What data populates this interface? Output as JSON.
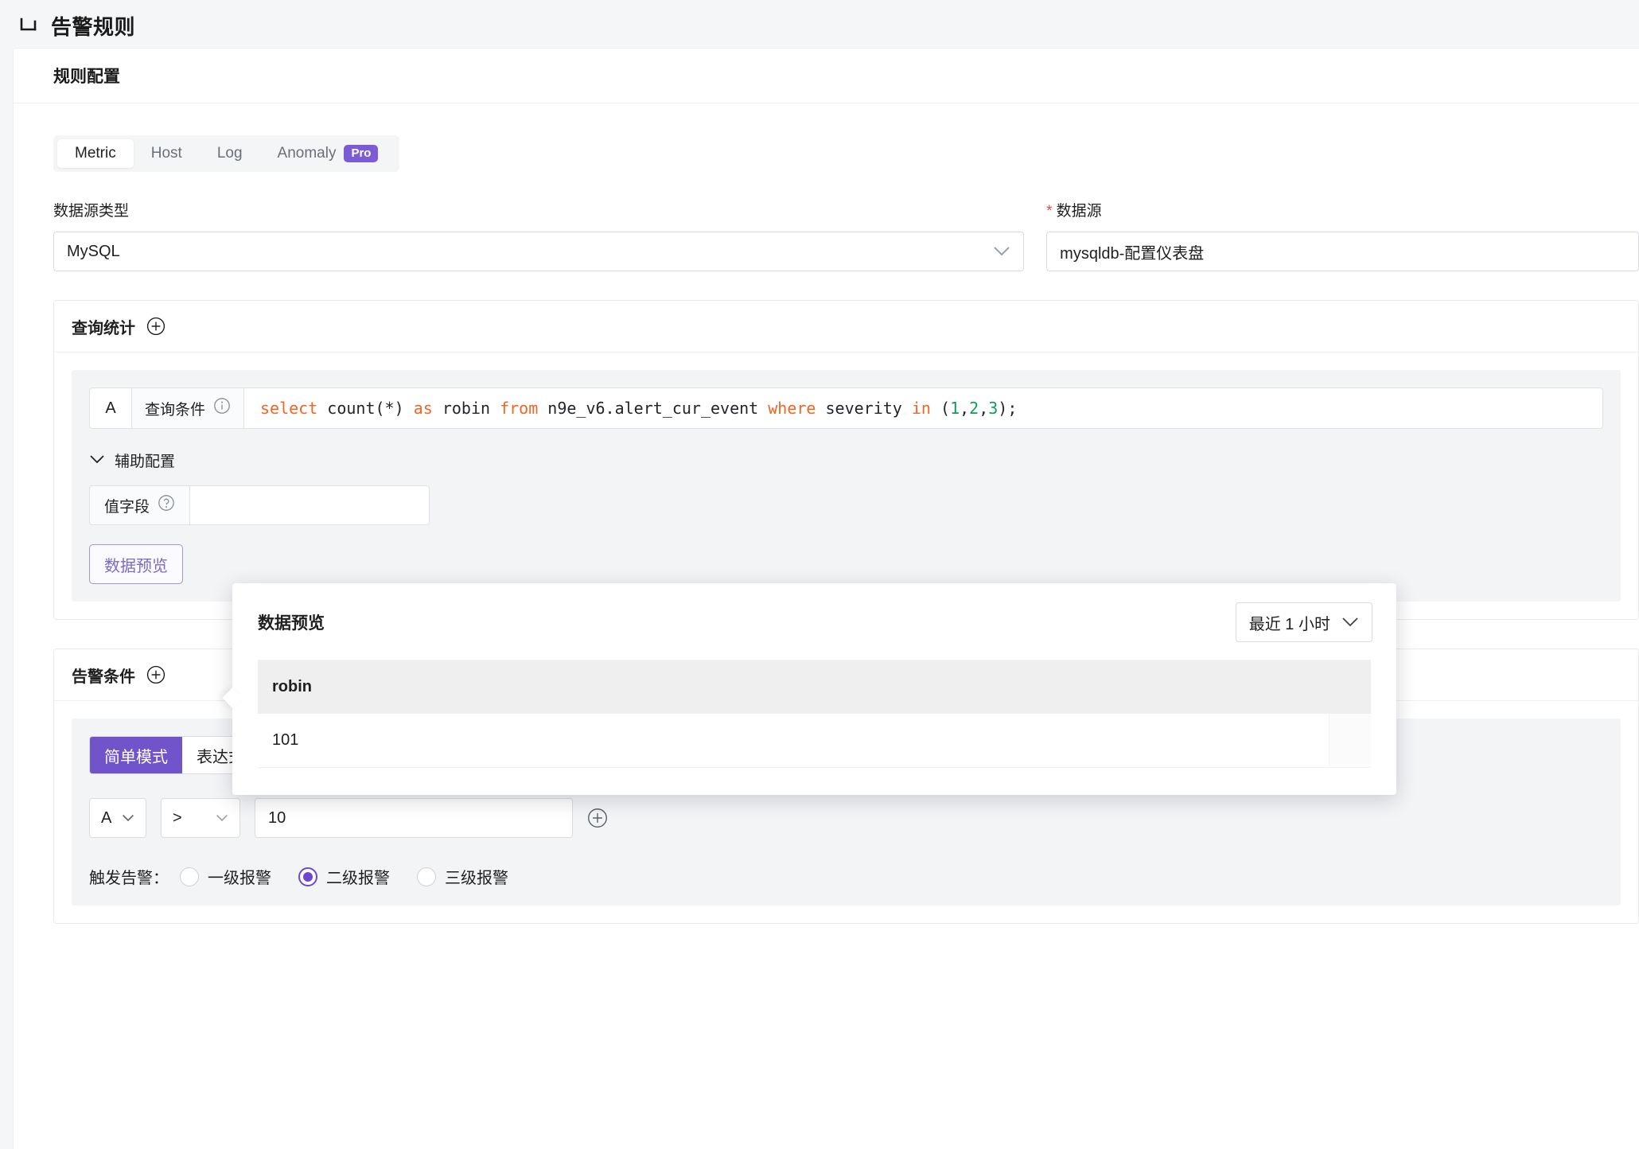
{
  "header": {
    "back_icon": "back-arrow-icon",
    "title": "告警规则"
  },
  "card": {
    "header_title": "规则配置"
  },
  "tabs": [
    {
      "label": "Metric",
      "active": true
    },
    {
      "label": "Host",
      "active": false
    },
    {
      "label": "Log",
      "active": false
    },
    {
      "label": "Anomaly",
      "active": false,
      "badge": "Pro"
    }
  ],
  "datasource_type": {
    "label": "数据源类型",
    "value": "MySQL"
  },
  "datasource": {
    "label": "数据源",
    "required_mark": "*",
    "value": "mysqldb-配置仪表盘"
  },
  "query_section": {
    "title": "查询统计",
    "add_icon": "plus-circle-icon",
    "row": {
      "badge": "A",
      "label": "查询条件",
      "info_icon": "info-circle-icon",
      "sql_tokens": [
        {
          "t": "select",
          "c": "kw"
        },
        {
          "t": " count(*) ",
          "c": "pln"
        },
        {
          "t": "as",
          "c": "kw"
        },
        {
          "t": " robin ",
          "c": "pln"
        },
        {
          "t": "from",
          "c": "kw"
        },
        {
          "t": " n9e_v6.alert_cur_event ",
          "c": "pln"
        },
        {
          "t": "where",
          "c": "kw"
        },
        {
          "t": " severity ",
          "c": "pln"
        },
        {
          "t": "in",
          "c": "kw"
        },
        {
          "t": " (",
          "c": "pln"
        },
        {
          "t": "1",
          "c": "num"
        },
        {
          "t": ",",
          "c": "pln"
        },
        {
          "t": "2",
          "c": "num"
        },
        {
          "t": ",",
          "c": "pln"
        },
        {
          "t": "3",
          "c": "num"
        },
        {
          "t": ");",
          "c": "pln"
        }
      ],
      "sql_text": "select count(*) as robin from n9e_v6.alert_cur_event where severity in (1,2,3);"
    },
    "aux": {
      "toggle_label": "辅助配置",
      "toggle_icon": "chevron-down-icon",
      "value_field_label": "值字段",
      "value_field_help_icon": "question-circle-icon",
      "value_field_value": ""
    },
    "preview_button": "数据预览"
  },
  "preview_popover": {
    "title": "数据预览",
    "time_range": "最近 1 小时",
    "time_range_icon": "chevron-down-icon",
    "columns": [
      "robin"
    ],
    "rows": [
      [
        "101"
      ]
    ]
  },
  "alert_section": {
    "title": "告警条件",
    "add_icon": "plus-circle-icon",
    "modes": [
      {
        "label": "简单模式",
        "active": true
      },
      {
        "label": "表达式模式",
        "active": false
      }
    ],
    "condition": {
      "series": "A",
      "operator": ">",
      "threshold": "10",
      "add_icon": "plus-circle-icon"
    },
    "trigger": {
      "label": "触发告警：",
      "options": [
        {
          "label": "一级报警",
          "checked": false
        },
        {
          "label": "二级报警",
          "checked": true
        },
        {
          "label": "三级报警",
          "checked": false
        }
      ]
    }
  },
  "colors": {
    "accent_purple": "#7154c9",
    "pro_badge": "#7c5cd6",
    "sql_keyword": "#f26522",
    "sql_number": "#0f9d58",
    "required_red": "#e44b4b"
  }
}
